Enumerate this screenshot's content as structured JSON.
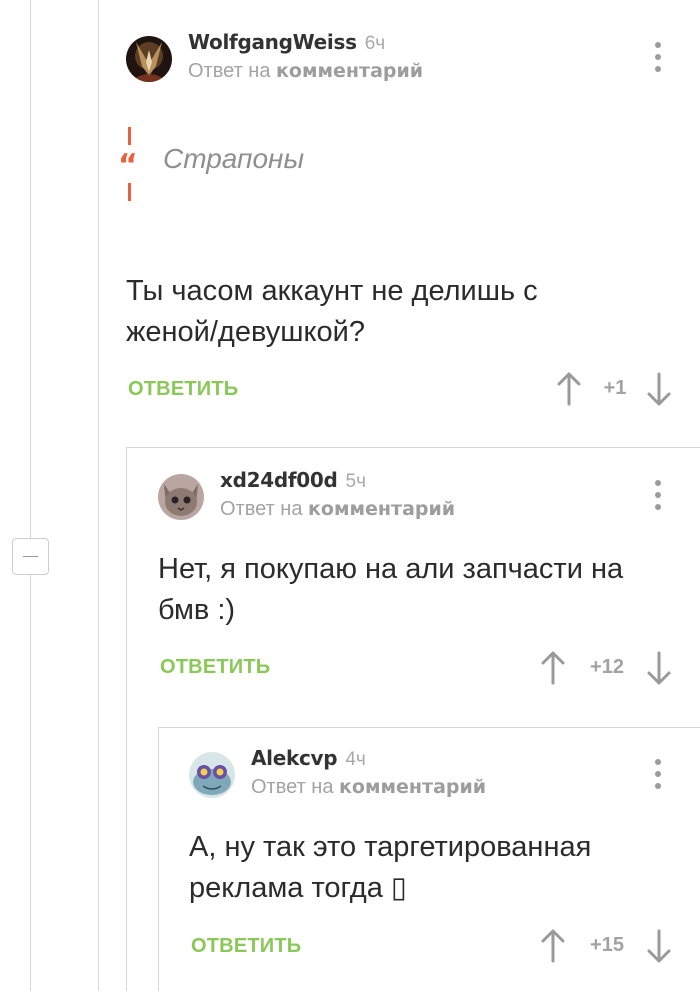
{
  "comments": [
    {
      "author": "WolfgangWeiss",
      "time": "6ч",
      "reply_prefix": "Ответ на",
      "reply_target": "комментарий",
      "quote": "Страпоны",
      "text_lines": [
        "Ты часом аккаунт не делишь с",
        "женой/девушкой?"
      ],
      "reply_label": "ОТВЕТИТЬ",
      "score": "+1"
    },
    {
      "author": "xd24df00d",
      "time": "5ч",
      "reply_prefix": "Ответ на",
      "reply_target": "комментарий",
      "text_lines": [
        "Нет, я покупаю на али запчасти на",
        "бмв :)"
      ],
      "reply_label": "ОТВЕТИТЬ",
      "score": "+12"
    },
    {
      "author": "Alekcvp",
      "time": "4ч",
      "reply_prefix": "Ответ на",
      "reply_target": "комментарий",
      "text_lines": [
        "А, ну так это таргетированная",
        "реклама тогда ▯"
      ],
      "reply_label": "ОТВЕТИТЬ",
      "score": "+15"
    }
  ],
  "icons": {
    "upvote": "arrow-up-icon",
    "downvote": "arrow-down-icon",
    "menu": "more-vertical-icon",
    "collapse": "minus-icon",
    "quote": "quote-mark-icon"
  },
  "colors": {
    "accent_green": "#8ac858",
    "quote_red": "#e8613c",
    "muted": "#a3a3a3"
  }
}
